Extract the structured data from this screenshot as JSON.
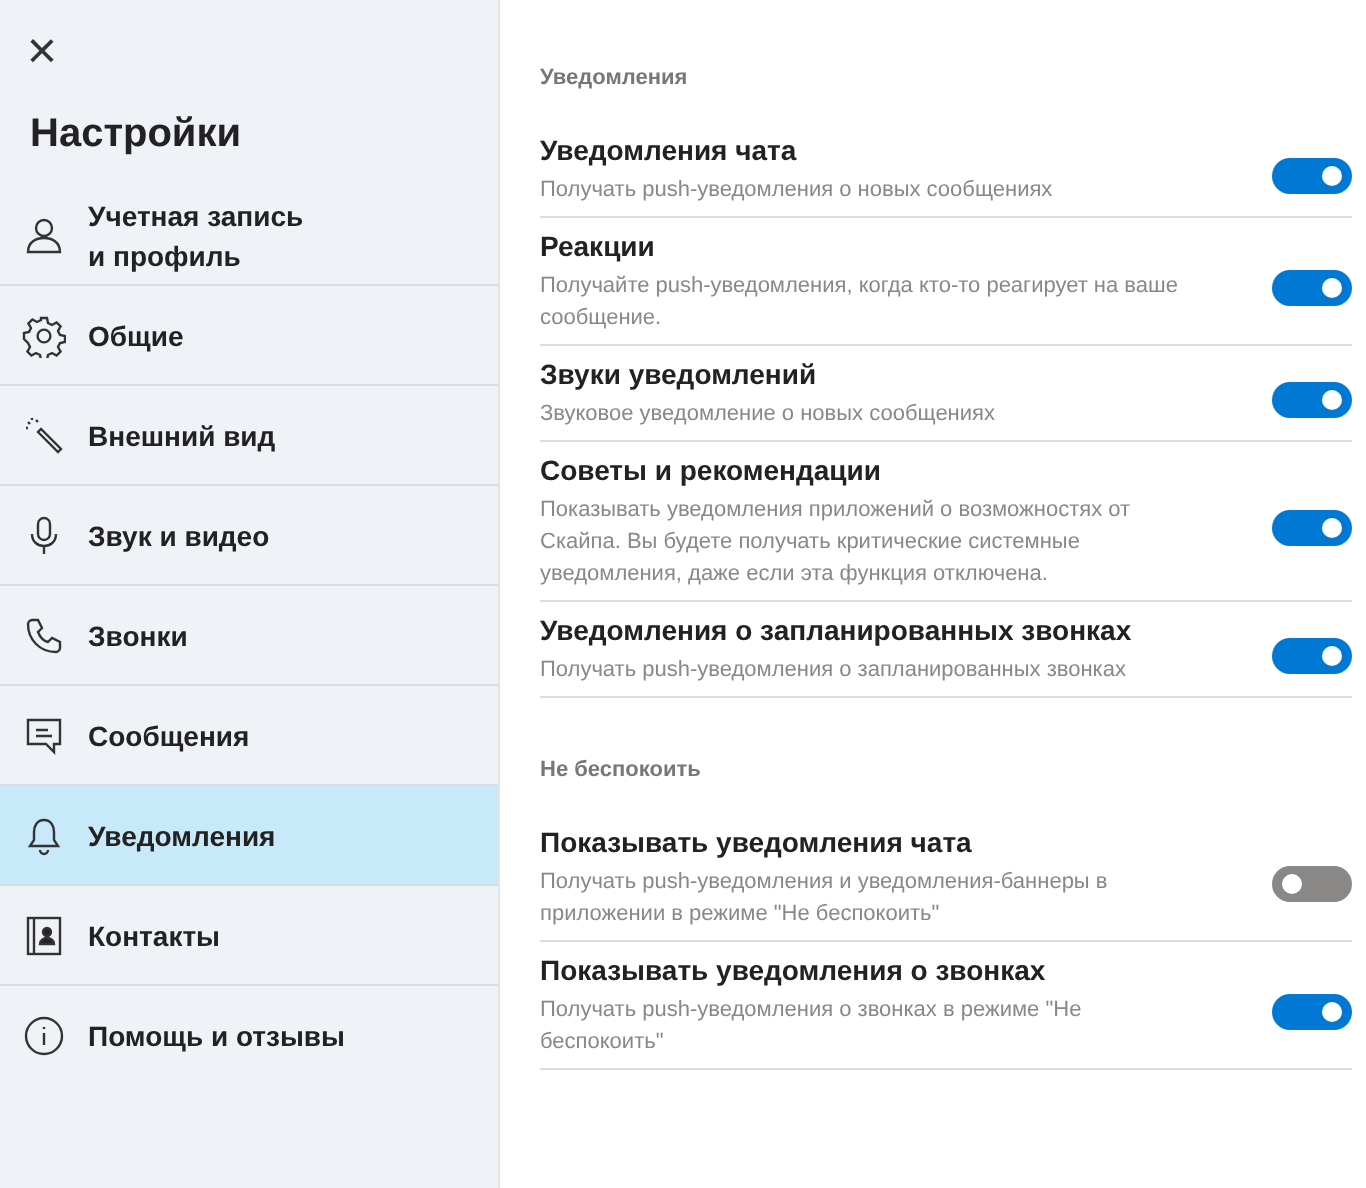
{
  "sidebar": {
    "close_icon": "×",
    "title": "Настройки",
    "items": [
      {
        "label": "Учетная запись и профиль",
        "kind": "person",
        "selected": false
      },
      {
        "label": "Общие",
        "kind": "gear",
        "selected": false
      },
      {
        "label": "Внешний вид",
        "kind": "wand",
        "selected": false
      },
      {
        "label": "Звук и видео",
        "kind": "mic",
        "selected": false
      },
      {
        "label": "Звонки",
        "kind": "phone",
        "selected": false
      },
      {
        "label": "Сообщения",
        "kind": "message",
        "selected": false
      },
      {
        "label": "Уведомления",
        "kind": "bell",
        "selected": true
      },
      {
        "label": "Контакты",
        "kind": "contacts",
        "selected": false
      },
      {
        "label": "Помощь и отзывы",
        "kind": "info",
        "selected": false
      }
    ]
  },
  "sections": [
    {
      "heading": "Уведомления",
      "settings": [
        {
          "title": "Уведомления чата",
          "description": "Получать push-уведомления о новых сообщениях",
          "on": true
        },
        {
          "title": "Реакции",
          "description": "Получайте push-уведомления, когда кто-то реагирует на ваше сообщение.",
          "on": true
        },
        {
          "title": "Звуки уведомлений",
          "description": "Звуковое уведомление о новых сообщениях",
          "on": true
        },
        {
          "title": "Советы и рекомендации",
          "description": "Показывать уведомления приложений о возможностях от Скайпа. Вы будете получать критические системные уведомления, даже если эта функция отключена.",
          "on": true
        },
        {
          "title": "Уведомления о запланированных звонках",
          "description": "Получать push-уведомления о запланированных звонках",
          "on": true
        }
      ]
    },
    {
      "heading": "Не беспокоить",
      "settings": [
        {
          "title": "Показывать уведомления чата",
          "description": "Получать push-уведомления и уведомления-баннеры в приложении в режиме \"Не беспокоить\"",
          "on": false
        },
        {
          "title": "Показывать уведомления о звонках",
          "description": "Получать push-уведомления о звонках в режиме \"Не беспокоить\"",
          "on": true
        }
      ]
    }
  ]
}
